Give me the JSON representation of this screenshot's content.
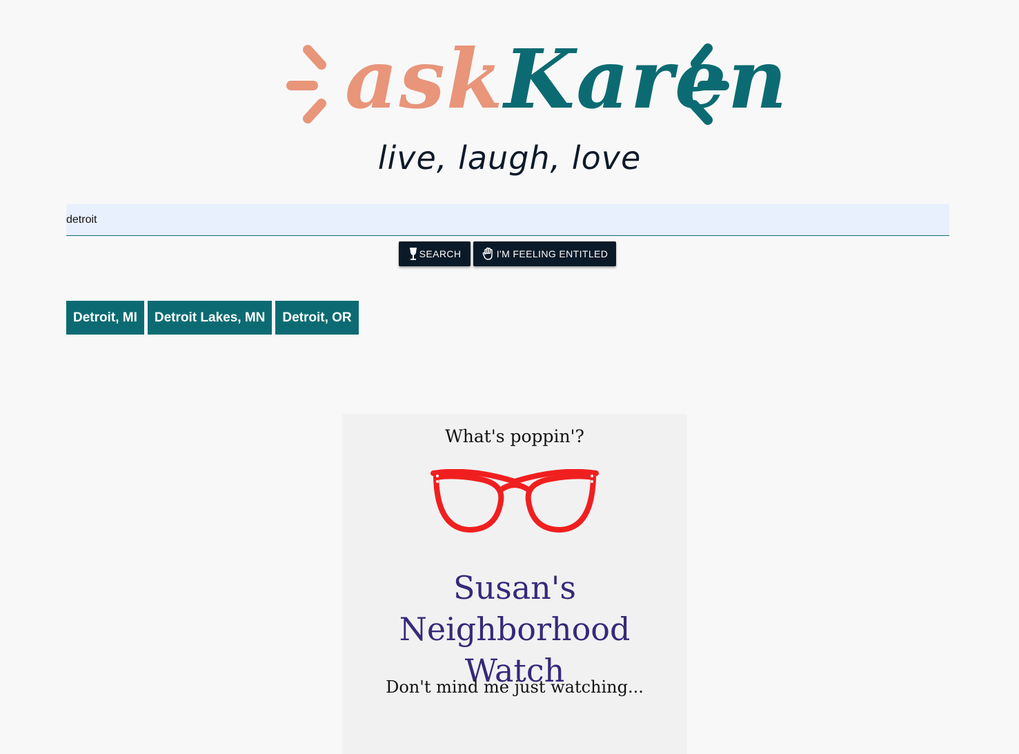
{
  "logo": {
    "ask": "ask",
    "karen": "Karen",
    "tagline": "live, laugh, love",
    "colors": {
      "ask": "#e8957a",
      "karen": "#0c6b72"
    }
  },
  "search": {
    "value": "detroit"
  },
  "buttons": {
    "search_label": "SEARCH",
    "search_icon": "wine-glass-icon",
    "entitled_label": "I'M FEELING ENTITLED",
    "entitled_icon": "raised-hand-icon"
  },
  "suggestions": [
    {
      "label": "Detroit, MI"
    },
    {
      "label": "Detroit Lakes, MN"
    },
    {
      "label": "Detroit, OR"
    }
  ],
  "card": {
    "kicker": "What's poppin'?",
    "image_icon": "red-glasses-icon",
    "title_line1": "Susan's Neighborhood",
    "title_line2": "Watch",
    "subtitle": "Don't mind me just watching..."
  },
  "colors": {
    "background": "#f8f8f8",
    "teal": "#0c6b72",
    "button_dark": "#0b1a28",
    "card_title": "#35297a",
    "glasses_red": "#f01f1f"
  }
}
